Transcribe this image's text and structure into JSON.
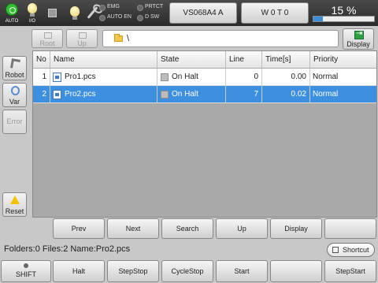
{
  "topbar": {
    "indicators": [
      {
        "name": "auto",
        "label": "AUTO",
        "icon": "auto-mode-icon"
      },
      {
        "name": "io",
        "label": "I/O",
        "icon": "lightbulb-icon"
      },
      {
        "name": "stop",
        "label": "",
        "icon": "stop-icon"
      },
      {
        "name": "light",
        "label": "",
        "icon": "lightbulb-icon"
      },
      {
        "name": "tool",
        "label": "",
        "icon": "wrench-icon"
      }
    ],
    "leds": [
      "EMG",
      "PRTCT",
      "AUTO EN",
      "D SW"
    ],
    "robot_button": "VS068A4 A",
    "tool_button": "W 0 T 0",
    "speed_percent": "15 %",
    "speed_value": 15
  },
  "pathbar": {
    "root_label": "Root",
    "up_label": "Up",
    "path": "\\",
    "display_label": "Display"
  },
  "sidebar": {
    "robot_label": "Robot",
    "var_label": "Var",
    "error_label": "Error",
    "reset_label": "Reset"
  },
  "table": {
    "columns": [
      "No",
      "Name",
      "State",
      "Line",
      "Time[s]",
      "Priority"
    ],
    "rows": [
      {
        "no": "1",
        "name": "Pro1.pcs",
        "state": "On Halt",
        "line": "0",
        "time": "0.00",
        "priority": "Normal",
        "selected": false
      },
      {
        "no": "2",
        "name": "Pro2.pcs",
        "state": "On Halt",
        "line": "7",
        "time": "0.02",
        "priority": "Normal",
        "selected": true
      }
    ]
  },
  "fbuttons": [
    "Prev",
    "Next",
    "Search",
    "Up",
    "Display",
    ""
  ],
  "info": {
    "text": "Folders:0  Files:2  Name:Pro2.pcs",
    "shortcut_label": "Shortcut"
  },
  "bottom_buttons": [
    "SHIFT",
    "Halt",
    "StepStop",
    "CycleStop",
    "Start",
    "",
    "StepStart"
  ],
  "colors": {
    "selection": "#3d8fe0",
    "progress": "#3a8fd8",
    "auto": "#2fbf2f"
  }
}
